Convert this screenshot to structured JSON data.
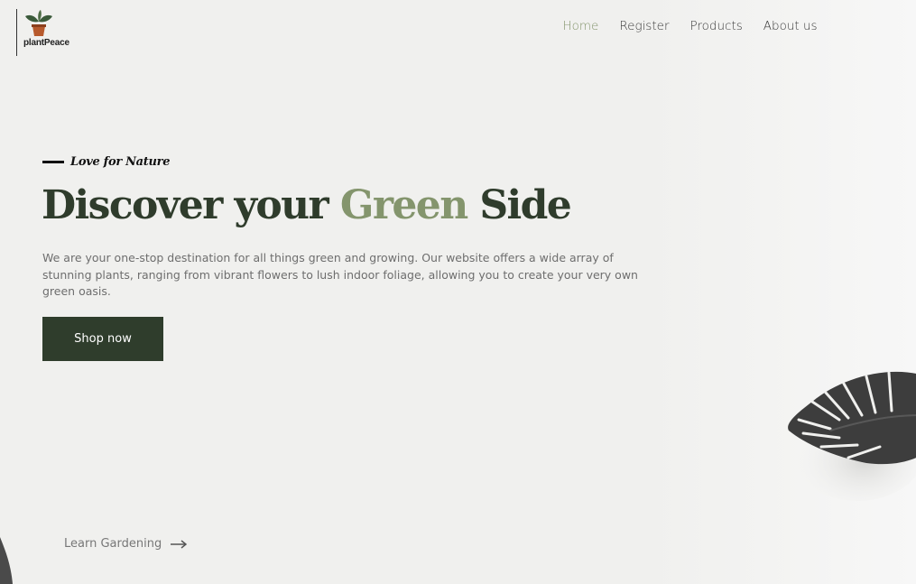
{
  "brand": {
    "name": "plantPeace",
    "icon": "potted-plant-icon"
  },
  "nav": {
    "items": [
      {
        "label": "Home",
        "active": true
      },
      {
        "label": "Register",
        "active": false
      },
      {
        "label": "Products",
        "active": false
      },
      {
        "label": "About us",
        "active": false
      }
    ]
  },
  "hero": {
    "eyebrow": "Love for Nature",
    "title_part1": "Discover your ",
    "title_accent": "Green",
    "title_part2": " Side",
    "description": "We are your one-stop destination for all things green and growing. Our website offers a wide array of stunning plants, ranging from vibrant flowers to lush indoor foliage, allowing you to create your very own green oasis.",
    "cta_label": "Shop now",
    "secondary_link": "Learn Gardening",
    "secondary_icon": "arrow-right-icon"
  },
  "colors": {
    "accent": "#84956d",
    "dark_green": "#2f3d2c",
    "background": "#f0f0ee"
  },
  "decor": {
    "plant_image": "monstera-leaf-icon"
  }
}
